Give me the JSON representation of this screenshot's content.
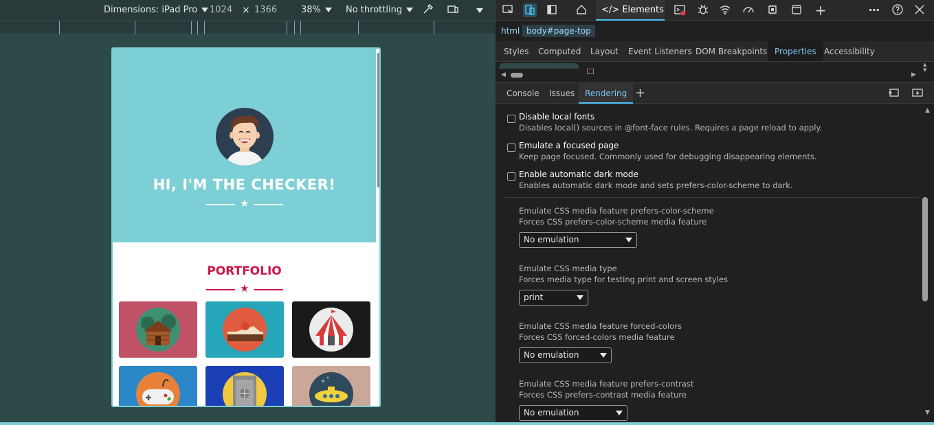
{
  "emulation_toolbar": {
    "dimensions_label": "Dimensions: iPad Pro",
    "width": "1024",
    "times": "×",
    "height": "1366",
    "zoom": "38%",
    "throttling": "No throttling"
  },
  "page": {
    "hero_title": "HI, I'M THE CHECKER!",
    "portfolio_title": "PORTFOLIO",
    "colors": {
      "hero_bg": "#7ccfd5",
      "accent": "#cf1546"
    },
    "tiles": [
      {
        "icon": "cabin-icon",
        "bg": "#c05268"
      },
      {
        "icon": "cake-icon",
        "bg": "#26a6b9"
      },
      {
        "icon": "circus-tent-icon",
        "bg": "#1a1a1a"
      },
      {
        "icon": "game-controller-icon",
        "bg": "#2b87c8"
      },
      {
        "icon": "safe-icon",
        "bg": "#1b3fb5"
      },
      {
        "icon": "submarine-icon",
        "bg": "#c9a898"
      }
    ]
  },
  "devtools": {
    "tabs": {
      "elements": "Elements"
    },
    "breadcrumbs": [
      "html",
      "body#page-top"
    ],
    "panel_tabs": [
      "Styles",
      "Computed",
      "Layout",
      "Event Listeners",
      "DOM Breakpoints",
      "Properties",
      "Accessibility"
    ],
    "active_panel_tab": "Properties",
    "drawer_tabs": [
      "Console",
      "Issues",
      "Rendering"
    ],
    "active_drawer_tab": "Rendering",
    "rendering": {
      "checkbox_options": [
        {
          "title": "Disable local fonts",
          "desc": "Disables local() sources in @font-face rules. Requires a page reload to apply."
        },
        {
          "title": "Emulate a focused page",
          "desc": "Keep page focused. Commonly used for debugging disappearing elements."
        },
        {
          "title": "Enable automatic dark mode",
          "desc": "Enables automatic dark mode and sets prefers-color-scheme to dark."
        }
      ],
      "emulations": [
        {
          "title": "Emulate CSS media feature prefers-color-scheme",
          "desc": "Forces CSS prefers-color-scheme media feature",
          "value": "No emulation"
        },
        {
          "title": "Emulate CSS media type",
          "desc": "Forces media type for testing print and screen styles",
          "value": "print"
        },
        {
          "title": "Emulate CSS media feature forced-colors",
          "desc": "Forces CSS forced-colors media feature",
          "value": "No emulation"
        },
        {
          "title": "Emulate CSS media feature prefers-contrast",
          "desc": "Forces CSS prefers-contrast media feature",
          "value": "No emulation"
        }
      ]
    }
  }
}
